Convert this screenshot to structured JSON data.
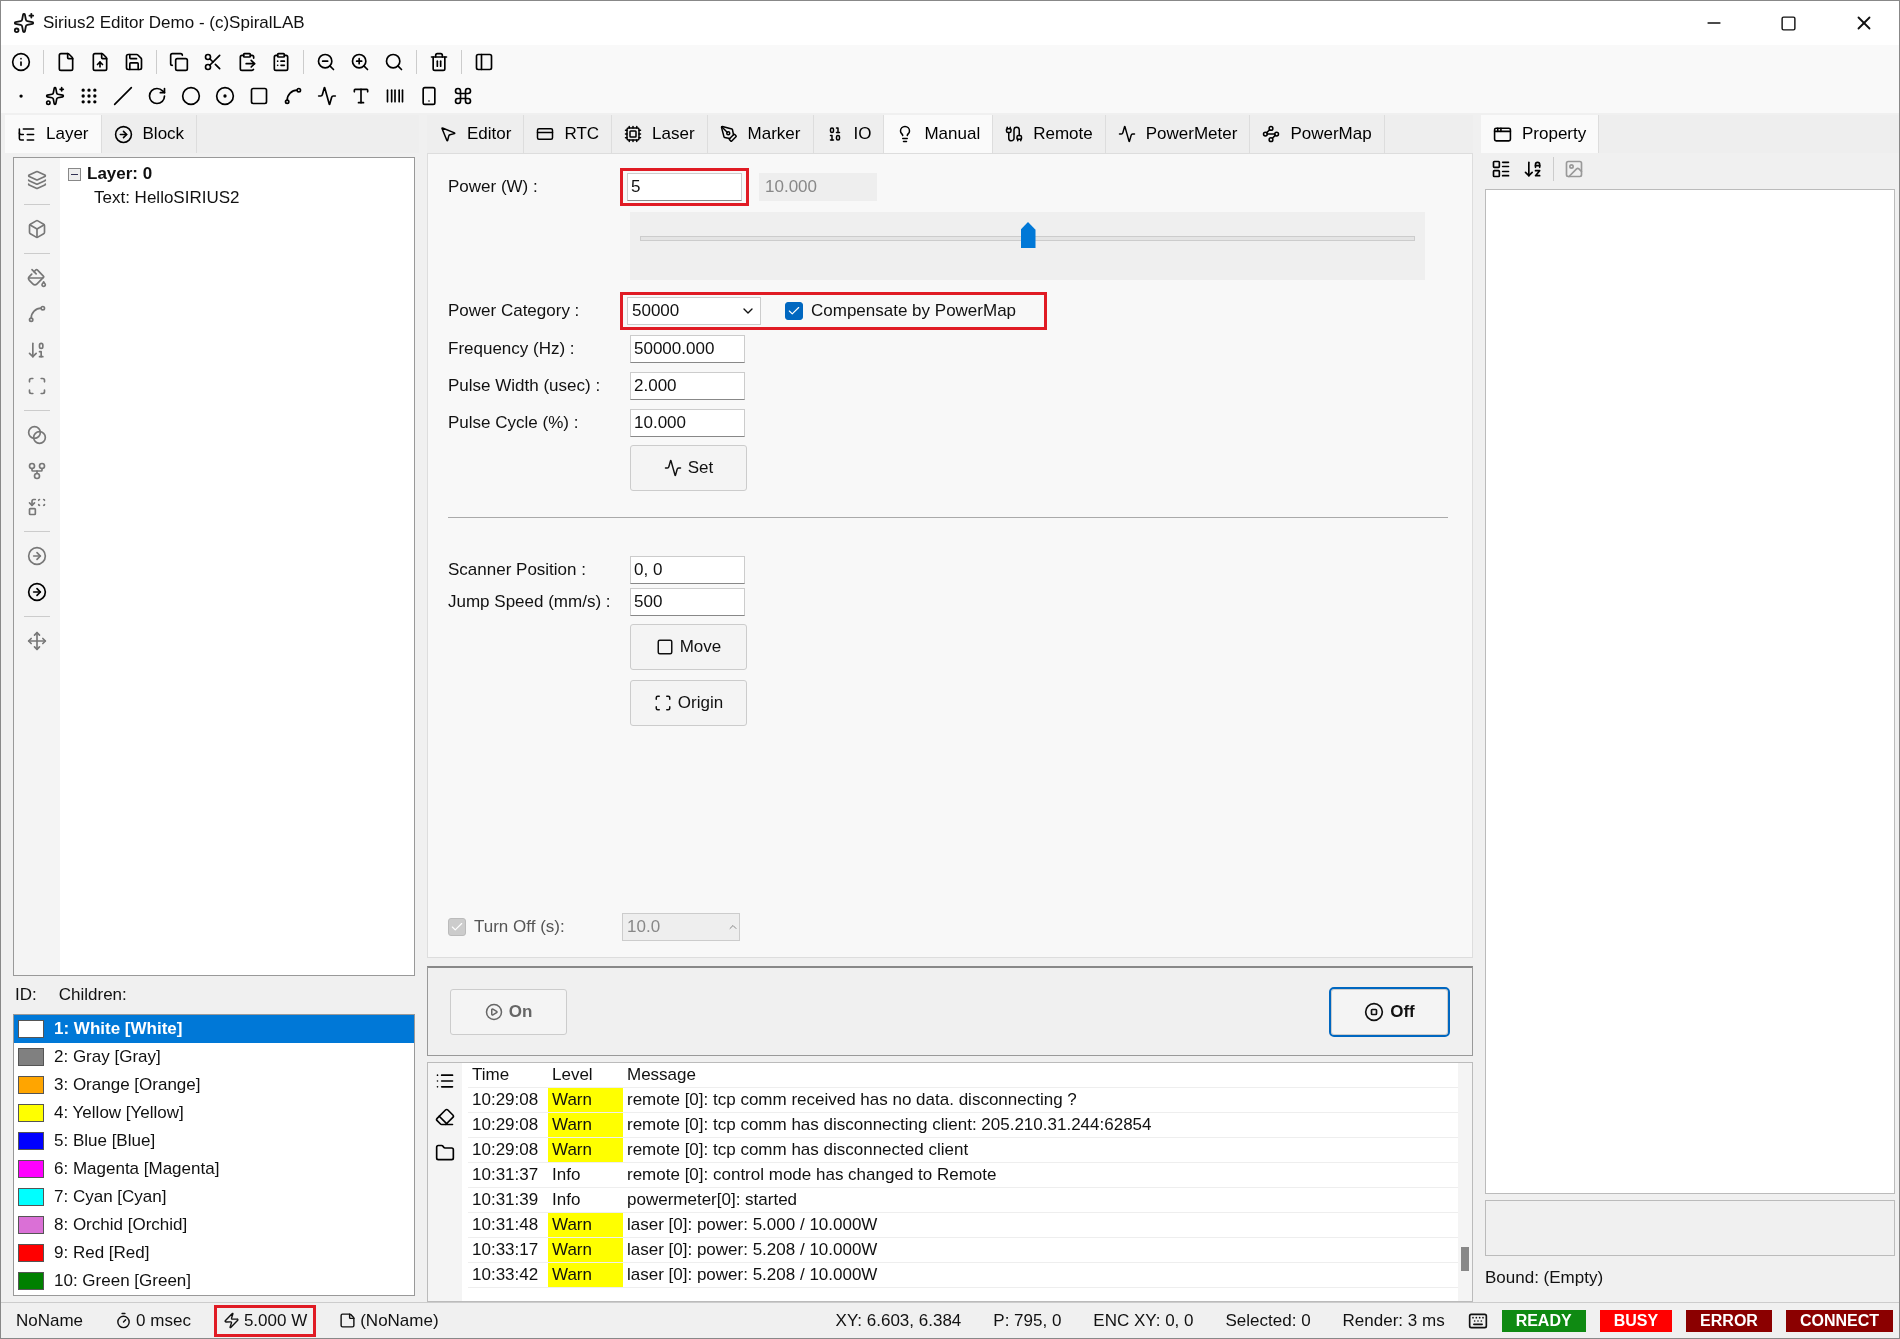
{
  "window": {
    "title": "Sirius2 Editor Demo - (c)SpiralLAB"
  },
  "left_tabs": [
    {
      "label": "Layer",
      "selected": true
    },
    {
      "label": "Block",
      "selected": false
    }
  ],
  "tree": [
    {
      "label": "Layer: 0",
      "expanded": true,
      "children": [
        {
          "label": "Text: HelloSIRIUS2"
        }
      ]
    }
  ],
  "list_header": [
    "ID:",
    "Children:"
  ],
  "pens": [
    {
      "label": "1: White [White]",
      "color": "#ffffff",
      "selected": true
    },
    {
      "label": "2: Gray [Gray]",
      "color": "#808080",
      "selected": false
    },
    {
      "label": "3: Orange [Orange]",
      "color": "#ffa500",
      "selected": false
    },
    {
      "label": "4: Yellow [Yellow]",
      "color": "#ffff00",
      "selected": false
    },
    {
      "label": "5: Blue [Blue]",
      "color": "#0000ff",
      "selected": false
    },
    {
      "label": "6: Magenta [Magenta]",
      "color": "#ff00ff",
      "selected": false
    },
    {
      "label": "7: Cyan [Cyan]",
      "color": "#00ffff",
      "selected": false
    },
    {
      "label": "8: Orchid [Orchid]",
      "color": "#da70d6",
      "selected": false
    },
    {
      "label": "9: Red [Red]",
      "color": "#ff0000",
      "selected": false
    },
    {
      "label": "10: Green [Green]",
      "color": "#008000",
      "selected": false
    }
  ],
  "tabs": [
    {
      "label": "Editor",
      "selected": false
    },
    {
      "label": "RTC",
      "selected": false
    },
    {
      "label": "Laser",
      "selected": false
    },
    {
      "label": "Marker",
      "selected": false
    },
    {
      "label": "IO",
      "selected": false
    },
    {
      "label": "Manual",
      "selected": true
    },
    {
      "label": "Remote",
      "selected": false
    },
    {
      "label": "PowerMeter",
      "selected": false
    },
    {
      "label": "PowerMap",
      "selected": false
    }
  ],
  "manual": {
    "power": {
      "label": "Power (W) :",
      "value": "5",
      "max": "10.000",
      "level": 0.5,
      "highlighted": true
    },
    "power_category": {
      "label": "Power Category :",
      "value": "50000",
      "highlighted": true
    },
    "compensate": {
      "label": "Compensate by PowerMap",
      "checked": true
    },
    "fields": [
      {
        "label": "Frequency (Hz) :",
        "value": "50000.000"
      },
      {
        "label": "Pulse Width (usec) :",
        "value": "2.000"
      },
      {
        "label": "Pulse Cycle (%) :",
        "value": "10.000"
      }
    ],
    "set_button": "Set",
    "scanner_fields": [
      {
        "label": "Scanner Position :",
        "value": "0, 0"
      },
      {
        "label": "Jump Speed (mm/s) :",
        "value": "500"
      }
    ],
    "move_button": "Move",
    "origin_button": "Origin",
    "turn_off": {
      "label": "Turn Off (s):",
      "checked": true,
      "disabled": true,
      "value": "10.0"
    },
    "on_button": {
      "label": "On",
      "disabled": true
    },
    "off_button": {
      "label": "Off",
      "focused": true
    }
  },
  "log": {
    "columns": [
      "Time",
      "Level",
      "Message"
    ],
    "rows": [
      {
        "time": "10:29:08",
        "level": "Warn",
        "message": "remote [0]: tcp comm received has no data. disconnecting ?",
        "highlighted": true
      },
      {
        "time": "10:29:08",
        "level": "Warn",
        "message": "remote [0]: tcp comm has disconnecting client: 205.210.31.244:62854",
        "highlighted": true
      },
      {
        "time": "10:29:08",
        "level": "Warn",
        "message": "remote [0]: tcp comm has disconnected client",
        "highlighted": true
      },
      {
        "time": "10:31:37",
        "level": "Info",
        "message": "remote [0]: control mode has changed to Remote",
        "highlighted": false
      },
      {
        "time": "10:31:39",
        "level": "Info",
        "message": "powermeter[0]: started",
        "highlighted": false
      },
      {
        "time": "10:31:48",
        "level": "Warn",
        "message": "laser [0]: power: 5.000 / 10.000W",
        "highlighted": true
      },
      {
        "time": "10:33:17",
        "level": "Warn",
        "message": "laser [0]: power: 5.208 / 10.000W",
        "highlighted": true
      },
      {
        "time": "10:33:42",
        "level": "Warn",
        "message": "laser [0]: power: 5.208 / 10.000W",
        "highlighted": true
      }
    ]
  },
  "property": {
    "tab": "Property",
    "bound": "Bound: (Empty)"
  },
  "status_bar": {
    "items": [
      {
        "text": "NoName",
        "highlighted": false
      },
      {
        "text": "0 msec",
        "highlighted": false
      },
      {
        "text": "5.000 W",
        "highlighted": true
      },
      {
        "text": "(NoName)",
        "highlighted": false
      }
    ],
    "right_items": [
      "XY: 6.603, 6.384",
      "P: 795, 0",
      "ENC XY: 0, 0",
      "Selected: 0",
      "Render: 3 ms"
    ],
    "indicators": [
      {
        "label": "READY",
        "color": "#0f8a12"
      },
      {
        "label": "BUSY",
        "color": "#ff0000"
      },
      {
        "label": "ERROR",
        "color": "#8b0000"
      },
      {
        "label": "CONNECT",
        "color": "#8b0000"
      }
    ]
  }
}
